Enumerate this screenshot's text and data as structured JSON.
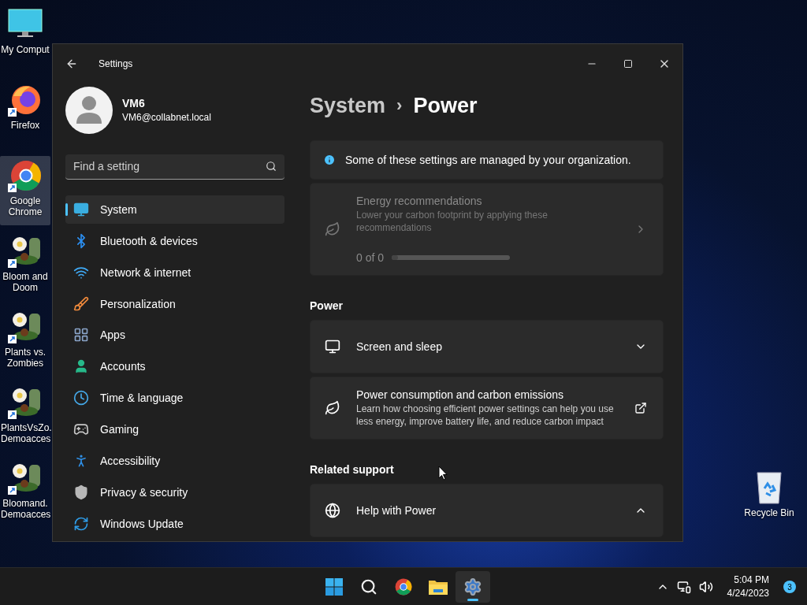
{
  "desktop_icons": [
    {
      "kind": "computer",
      "label": "My Comput",
      "selected": false
    },
    {
      "kind": "firefox",
      "label": "Firefox",
      "selected": false
    },
    {
      "kind": "chrome",
      "label": "Google Chrome",
      "selected": true
    },
    {
      "kind": "plant",
      "label": "Bloom and Doom",
      "selected": false
    },
    {
      "kind": "plant",
      "label": "Plants vs. Zombies",
      "selected": false
    },
    {
      "kind": "plant",
      "label": "PlantsVsZo. Demoacces",
      "selected": false
    },
    {
      "kind": "plant",
      "label": "Bloomand. Demoacces",
      "selected": false
    }
  ],
  "recycle_bin": {
    "label": "Recycle Bin"
  },
  "window": {
    "title": "Settings"
  },
  "profile": {
    "name": "VM6",
    "email": "VM6@collabnet.local"
  },
  "search": {
    "placeholder": "Find a setting"
  },
  "sidebar": {
    "items": [
      {
        "kind": "system",
        "label": "System",
        "selected": true
      },
      {
        "kind": "bluetooth",
        "label": "Bluetooth & devices",
        "selected": false
      },
      {
        "kind": "network",
        "label": "Network & internet",
        "selected": false
      },
      {
        "kind": "personalization",
        "label": "Personalization",
        "selected": false
      },
      {
        "kind": "apps",
        "label": "Apps",
        "selected": false
      },
      {
        "kind": "accounts",
        "label": "Accounts",
        "selected": false
      },
      {
        "kind": "time",
        "label": "Time & language",
        "selected": false
      },
      {
        "kind": "gaming",
        "label": "Gaming",
        "selected": false
      },
      {
        "kind": "accessibility",
        "label": "Accessibility",
        "selected": false
      },
      {
        "kind": "privacy",
        "label": "Privacy & security",
        "selected": false
      },
      {
        "kind": "update",
        "label": "Windows Update",
        "selected": false
      }
    ]
  },
  "breadcrumb": {
    "parent": "System",
    "separator": "›",
    "current": "Power"
  },
  "info_bar": {
    "text": "Some of these settings are managed by your organization."
  },
  "energy_card": {
    "title": "Energy recommendations",
    "description": "Lower your carbon footprint by applying these recommendations",
    "count": "0 of 0",
    "level": 0,
    "disabled": true
  },
  "sections": [
    {
      "heading": "Power",
      "cards": [
        {
          "kind": "sleep",
          "title": "Screen and sleep",
          "expanded": false
        },
        {
          "kind": "emissions",
          "title": "Power consumption and carbon emissions",
          "description": "Learn how choosing efficient power settings can help you use less energy, improve battery life, and reduce carbon impact"
        }
      ]
    },
    {
      "heading": "Related support",
      "cards": [
        {
          "kind": "help",
          "title": "Help with Power",
          "expanded": true
        }
      ]
    }
  ],
  "taskbar": {
    "apps": [
      {
        "kind": "start",
        "active": false
      },
      {
        "kind": "search",
        "active": false
      },
      {
        "kind": "chrome",
        "active": false
      },
      {
        "kind": "explorer",
        "active": false
      },
      {
        "kind": "settings",
        "active": true
      }
    ],
    "time": "5:04 PM",
    "date": "4/24/2023",
    "notifications": "3"
  }
}
